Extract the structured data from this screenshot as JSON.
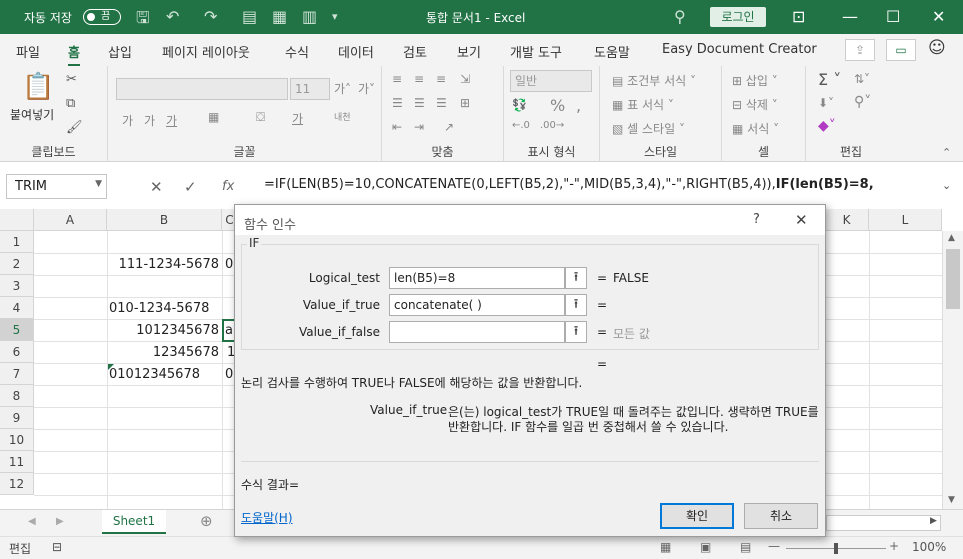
{
  "titlebar": {
    "autosave_label": "자동 저장",
    "autosave_state": "끔",
    "title": "통합 문서1 - Excel",
    "login": "로그인"
  },
  "tabs": [
    "파일",
    "홈",
    "삽입",
    "페이지 레이아웃",
    "수식",
    "데이터",
    "검토",
    "보기",
    "개발 도구",
    "도움말",
    "Easy Document Creator"
  ],
  "active_tab": "홈",
  "ribbon": {
    "clipboard": {
      "paste": "붙여넣기",
      "label": "클립보드"
    },
    "font": {
      "size": "11",
      "label": "글꼴"
    },
    "align": {
      "label": "맞춤"
    },
    "number": {
      "format": "일반",
      "label": "표시 형식"
    },
    "styles": {
      "cond": "조건부 서식",
      "table": "표 서식",
      "cell": "셀 스타일",
      "label": "스타일"
    },
    "cells": {
      "insert": "삽입",
      "delete": "삭제",
      "format": "서식",
      "label": "셀"
    },
    "edit": {
      "label": "편집"
    }
  },
  "formula_bar": {
    "name_box": "TRIM",
    "formula_plain": "=IF(LEN(B5)=10,CONCATENATE(0,LEFT(B5,2),\"-\",MID(B5,3,4),\"-\",RIGHT(B5,4)),",
    "formula_bold": "IF(len(B5)=8,"
  },
  "sheet": {
    "columns": [
      "A",
      "B",
      "C",
      "K",
      "L"
    ],
    "rows": [
      "1",
      "2",
      "3",
      "4",
      "5",
      "6",
      "7",
      "8",
      "9",
      "10",
      "11",
      "12"
    ],
    "cells": {
      "b2": "111-1234-5678",
      "c2": "0",
      "b4": "010-1234-5678",
      "b5": "1012345678",
      "c5": "a",
      "b6": "12345678",
      "c6": "1",
      "b7": "01012345678",
      "c7": "0"
    },
    "sheet_tab": "Sheet1"
  },
  "status": {
    "mode": "편집",
    "zoom": "100%"
  },
  "dialog": {
    "title": "함수 인수",
    "help_q": "?",
    "function": "IF",
    "args": [
      {
        "label": "Logical_test",
        "value": "len(B5)=8",
        "result": "FALSE"
      },
      {
        "label": "Value_if_true",
        "value": "concatenate( )",
        "result": ""
      },
      {
        "label": "Value_if_false",
        "value": "",
        "result": "모든 값"
      }
    ],
    "eq": "=",
    "description": "논리 검사를 수행하여 TRUE나 FALSE에 해당하는 값을 반환합니다.",
    "arg_name": "Value_if_true",
    "arg_desc_1": "은(는) logical_test가 TRUE일 때 돌려주는 값입니다. 생략하면 TRUE를",
    "arg_desc_2": "반환합니다. IF 함수를 일곱 번 중첩해서 쓸 수 있습니다.",
    "result_label": "수식 결과=",
    "help_link": "도움말(H)",
    "ok": "확인",
    "cancel": "취소"
  },
  "colors": {
    "excel_green": "#217346",
    "accent_blue": "#0078d7"
  }
}
